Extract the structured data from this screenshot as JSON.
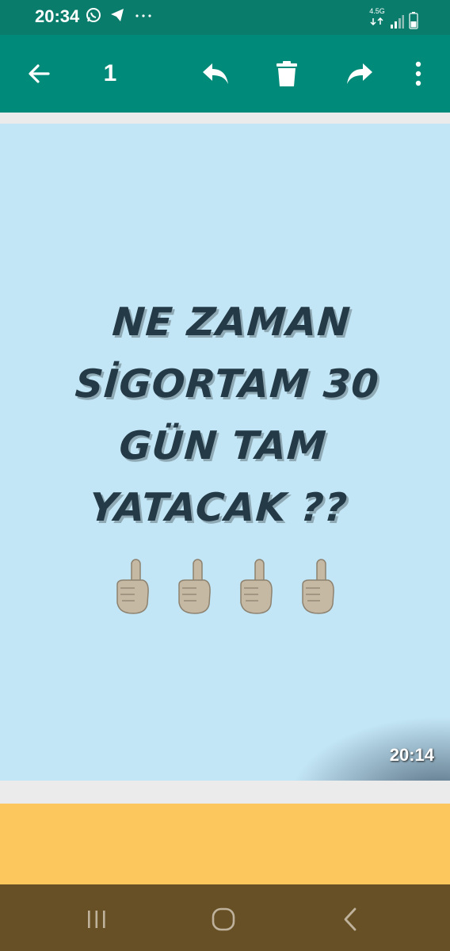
{
  "status_bar": {
    "time": "20:34",
    "network_label": "4.5G",
    "icons": [
      "whatsapp-icon",
      "telegram-icon",
      "more-dots-icon",
      "signal-icon",
      "battery-icon"
    ]
  },
  "toolbar": {
    "selected_count": "1",
    "icons": [
      "back-arrow-icon",
      "reply-icon",
      "delete-icon",
      "forward-icon",
      "overflow-menu-icon"
    ]
  },
  "media": {
    "headline_lines": [
      "NE ZAMAN",
      "SİGORTAM 30",
      "GÜN TAM",
      "YATACAK ??"
    ],
    "emoji": "☝🏼☝🏼☝🏼☝🏼",
    "timestamp": "20:14",
    "background_color": "#c3e6f6",
    "text_color": "#243a46"
  },
  "colors": {
    "status_bar": "#0a7c6b",
    "toolbar": "#008a79",
    "next_card": "#fcc85d",
    "nav_bar": "#675025"
  },
  "nav_bar": {
    "icons": [
      "recent-apps-icon",
      "home-icon",
      "back-icon"
    ]
  }
}
